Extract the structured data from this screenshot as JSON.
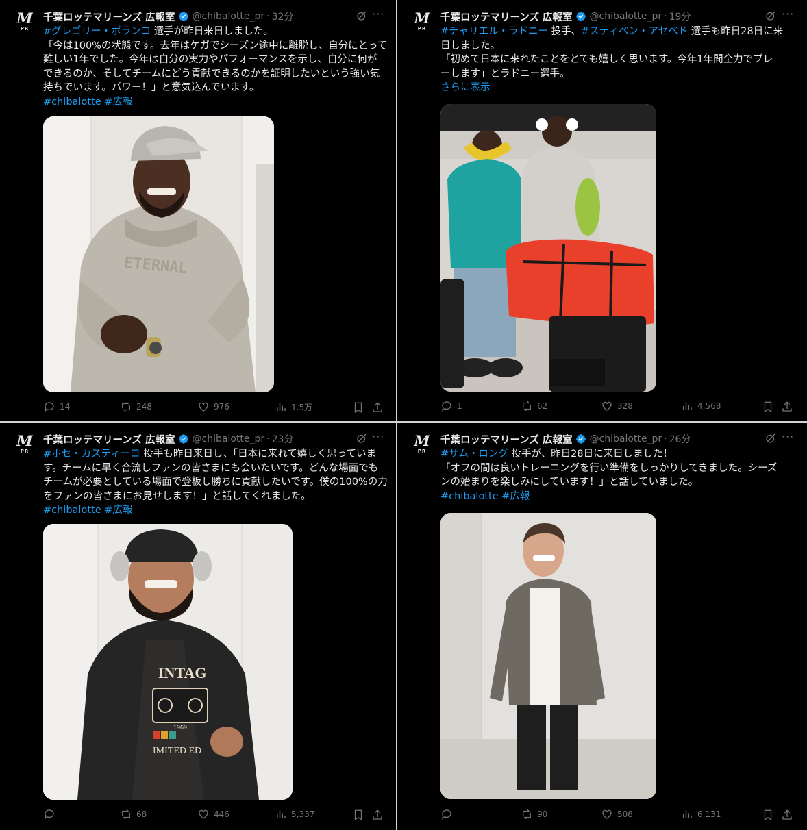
{
  "account": {
    "name": "千葉ロッテマリーンズ 広報室",
    "handle": "@chibalotte_pr",
    "avatar_mark": "M",
    "avatar_sub": "PR",
    "dot": "·",
    "more": "···"
  },
  "colors": {
    "link": "#1d9bf0",
    "muted": "#71767b",
    "text": "#e7e9ea",
    "verified": "#1d9bf0"
  },
  "tweets": [
    {
      "time": "32分",
      "lines": [
        [
          {
            "t": "#グレゴリー・ポランコ",
            "link": true
          },
          {
            "t": " 選手が昨日来日しました。"
          }
        ],
        [
          {
            "t": "「今は100%の状態です。去年はケガでシーズン途中に離脱し、自分にとって"
          }
        ],
        [
          {
            "t": "難しい1年でした。今年は自分の実力やパフォーマンスを示し、自分に何が"
          }
        ],
        [
          {
            "t": "できるのか、そしてチームにどう貢献できるのかを証明したいという強い気"
          }
        ],
        [
          {
            "t": "持ちでいます。パワー！」と意気込んでいます。"
          }
        ],
        [
          {
            "t": "#chibalotte",
            "link": true
          },
          {
            "t": " "
          },
          {
            "t": "#広報",
            "link": true
          }
        ]
      ],
      "media_alt": "hoodie-ETERNAL",
      "stats": {
        "replies": "14",
        "reposts": "248",
        "likes": "976",
        "views": "1.5万"
      }
    },
    {
      "time": "19分",
      "lines": [
        [
          {
            "t": "#チャリエル・ラドニー",
            "link": true
          },
          {
            "t": " 投手、"
          },
          {
            "t": "#スティベン・アセベド",
            "link": true
          },
          {
            "t": " 選手も昨日28日に来"
          }
        ],
        [
          {
            "t": "日しました。"
          }
        ],
        [
          {
            "t": "「初めて日本に来れたことをとても嬉しく思います。今年1年間全力でプレ"
          }
        ],
        [
          {
            "t": "ーします」とラドニー選手。"
          }
        ],
        [
          {
            "t": "さらに表示",
            "link": true
          }
        ]
      ],
      "stats": {
        "replies": "1",
        "reposts": "62",
        "likes": "328",
        "views": "4,568"
      }
    },
    {
      "time": "23分",
      "lines": [
        [
          {
            "t": "#ホセ・カスティーヨ",
            "link": true
          },
          {
            "t": " 投手も昨日来日し、「日本に来れて嬉しく思っていま"
          }
        ],
        [
          {
            "t": "す。チームに早く合流しファンの皆さまにも会いたいです。どんな場面でも"
          }
        ],
        [
          {
            "t": "チームが必要としている場面で登板し勝ちに貢献したいです。僕の100%の力"
          }
        ],
        [
          {
            "t": "をファンの皆さまにお見せします！」と話してくれました。"
          }
        ],
        [
          {
            "t": "#chibalotte",
            "link": true
          },
          {
            "t": " "
          },
          {
            "t": "#広報",
            "link": true
          }
        ]
      ],
      "shirt_text": "INTAG",
      "shirt_bottom": "IMITED ED",
      "shirt_year": "1969",
      "stats": {
        "replies": "",
        "reposts": "68",
        "likes": "446",
        "views": "5,337"
      }
    },
    {
      "time": "26分",
      "lines": [
        [
          {
            "t": "#サム・ロング",
            "link": true
          },
          {
            "t": " 投手が、昨日28日に来日しました！"
          }
        ],
        [
          {
            "t": "「オフの間は良いトレーニングを行い準備をしっかりしてきました。シーズ"
          }
        ],
        [
          {
            "t": "ンの始まりを楽しみにしています！」と話していました。"
          }
        ],
        [
          {
            "t": "#chibalotte",
            "link": true
          },
          {
            "t": " "
          },
          {
            "t": "#広報",
            "link": true
          }
        ]
      ],
      "stats": {
        "replies": "",
        "reposts": "90",
        "likes": "508",
        "views": "6,131"
      }
    }
  ],
  "icons": {
    "reply": "reply-icon",
    "repost": "repost-icon",
    "like": "heart-icon",
    "views": "views-icon",
    "bookmark": "bookmark-icon",
    "share": "share-icon",
    "grok": "grok-icon",
    "more": "more-icon",
    "verified": "verified-badge-icon"
  }
}
